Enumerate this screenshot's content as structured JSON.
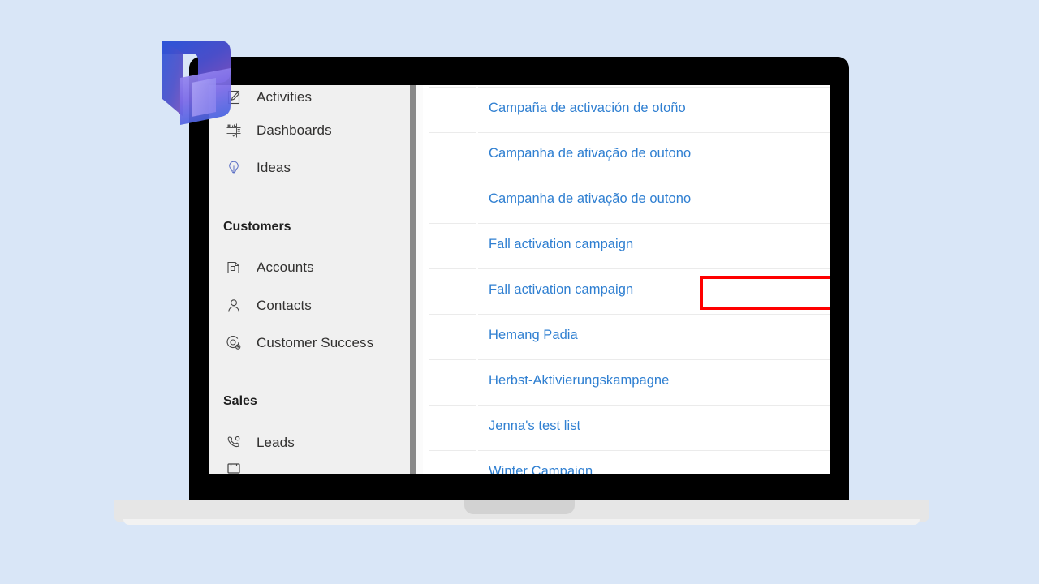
{
  "theme": {
    "page_background": "#d9e6f7",
    "link_color": "#2f7fd1",
    "sidebar_background": "#f0f0f0",
    "highlight_color": "#ff0000",
    "text_color": "#323130"
  },
  "logo": {
    "name": "dynamics-365-logo",
    "colors": [
      "#2b54c8",
      "#6a52c0",
      "#7b6ae0",
      "#8d8cf0"
    ]
  },
  "sidebar": {
    "items": [
      {
        "label": "Activities",
        "icon": "activities-icon"
      },
      {
        "label": "Dashboards",
        "icon": "dashboards-icon"
      },
      {
        "label": "Ideas",
        "icon": "lightbulb-icon"
      },
      {
        "label": "Accounts",
        "icon": "accounts-icon"
      },
      {
        "label": "Contacts",
        "icon": "contact-person-icon"
      },
      {
        "label": "Customer Success",
        "icon": "customer-success-icon"
      },
      {
        "label": "Leads",
        "icon": "leads-phone-icon"
      }
    ],
    "groups": [
      {
        "label": "Customers"
      },
      {
        "label": "Sales"
      }
    ]
  },
  "list": {
    "rows": [
      {
        "label": "Campaña de activación de otoño",
        "highlighted": false
      },
      {
        "label": "Campanha de ativação de outono",
        "highlighted": false
      },
      {
        "label": "Campanha de ativação de outono",
        "highlighted": false
      },
      {
        "label": "Fall activation campaign",
        "highlighted": false
      },
      {
        "label": "Fall activation campaign",
        "highlighted": true
      },
      {
        "label": "Hemang Padia",
        "highlighted": false
      },
      {
        "label": "Herbst-Aktivierungskampagne",
        "highlighted": false
      },
      {
        "label": "Jenna's test list",
        "highlighted": false
      },
      {
        "label": "Winter Campaign",
        "highlighted": false
      }
    ]
  },
  "scrollbar": {
    "name": "vertical-scrollbar"
  }
}
